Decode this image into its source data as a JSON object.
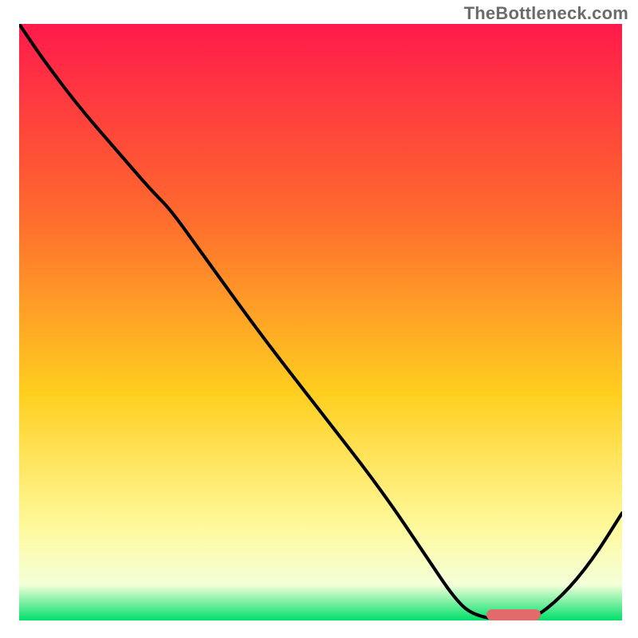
{
  "watermark": "TheBottleneck.com",
  "colors": {
    "gradient_top": "#ff1a4b",
    "gradient_upper_mid": "#ff6a2e",
    "gradient_mid": "#ffcf1f",
    "gradient_low_yellow": "#fff99a",
    "gradient_pale": "#f4ffd9",
    "gradient_bottom": "#00e06a",
    "curve": "#000000",
    "marker": "#e26a6a"
  },
  "chart_data": {
    "type": "line",
    "title": "",
    "xlabel": "",
    "ylabel": "",
    "xlim": [
      0,
      100
    ],
    "ylim": [
      0,
      100
    ],
    "grid": false,
    "series": [
      {
        "name": "bottleneck-curve",
        "x": [
          0,
          4,
          10,
          16,
          22,
          25,
          30,
          40,
          50,
          60,
          68,
          72,
          75,
          80,
          85,
          90,
          95,
          100
        ],
        "y": [
          100,
          94,
          86,
          79,
          72,
          69,
          62,
          48,
          35,
          22,
          10,
          4,
          1,
          0,
          0,
          4,
          10,
          18
        ]
      }
    ],
    "annotations": [
      {
        "name": "optimal-range-marker",
        "x_center": 82,
        "y_center": 1,
        "width_x_units": 9,
        "shape": "pill"
      }
    ],
    "note": "Chart has no visible axis ticks or numeric labels; x and y are in percent of plot area (0–100). Curve values estimated from pixel positions."
  }
}
